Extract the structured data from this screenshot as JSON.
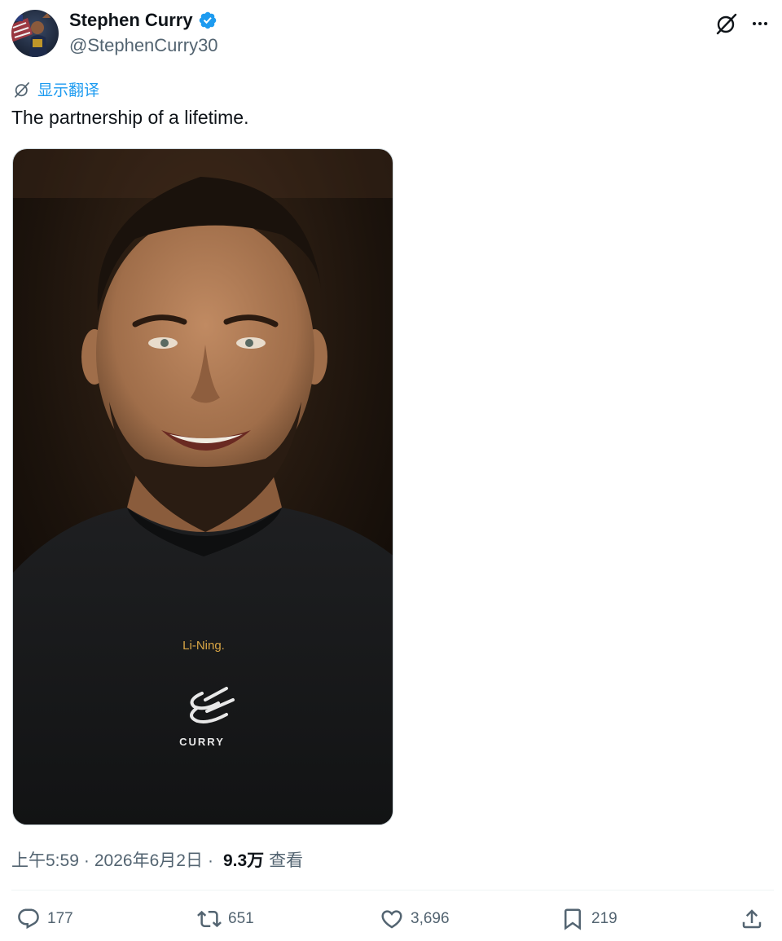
{
  "author": {
    "display_name": "Stephen Curry",
    "handle": "@StephenCurry30",
    "verified": true,
    "verified_color": "#1d9bf0"
  },
  "header_icons": [
    "grok-icon",
    "more-icon"
  ],
  "translate": {
    "label": "显示翻译",
    "icon": "grok-icon",
    "color": "#1d9bf0"
  },
  "tweet": {
    "text": "The partnership of a lifetime."
  },
  "media": {
    "shirt_brand_text": "Li-Ning.",
    "shirt_logo_text": "CURRY"
  },
  "meta": {
    "time": "上午5:59",
    "separator": "·",
    "date": "2026年6月2日",
    "views_count": "9.3万",
    "views_label": "查看"
  },
  "actions": {
    "replies": "177",
    "reposts": "651",
    "likes": "3,696",
    "bookmarks": "219"
  },
  "colors": {
    "text": "#0f1419",
    "secondary": "#536471",
    "accent": "#1d9bf0"
  }
}
